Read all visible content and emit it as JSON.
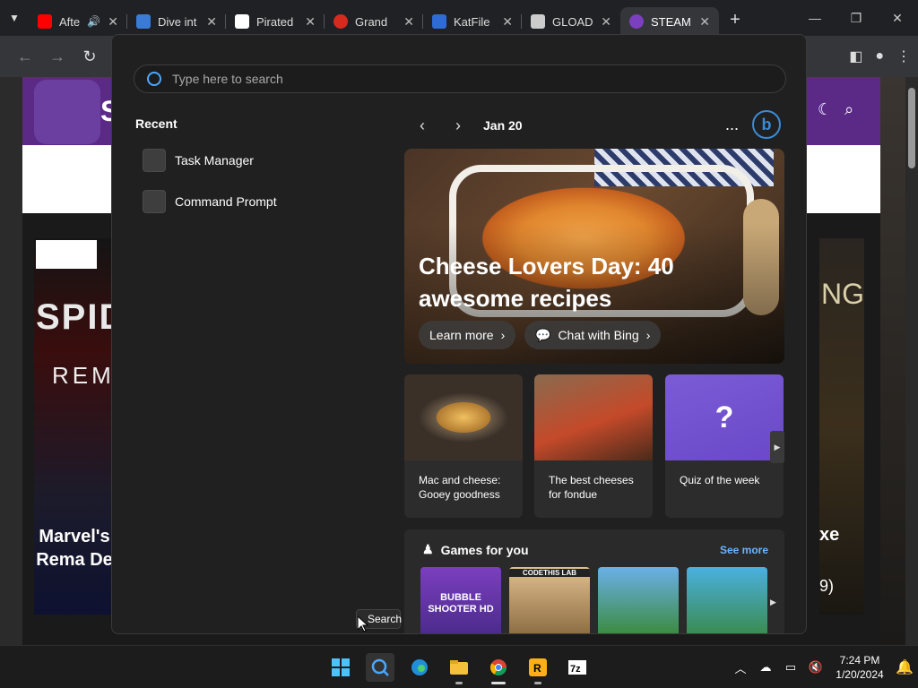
{
  "browser": {
    "tabs": [
      {
        "title": "Afte",
        "icon": "youtube-icon",
        "color": "#ff0000"
      },
      {
        "title": "Dive int",
        "icon": "dive-icon",
        "color": "#3a7bd5"
      },
      {
        "title": "Pirated",
        "icon": "piratedgames-icon",
        "color": "#ffffff"
      },
      {
        "title": "Grand",
        "icon": "mario-icon",
        "color": "#d52b1e"
      },
      {
        "title": "KatFile",
        "icon": "katfile-icon",
        "color": "#2f6bd6"
      },
      {
        "title": "GLOAD",
        "icon": "gamepad-icon",
        "color": "#cccccc"
      },
      {
        "title": "STEAM",
        "icon": "steamrip-icon",
        "color": "#7b3fbf"
      }
    ],
    "new_tab": "+"
  },
  "page": {
    "poster_left_title_1": "SPID",
    "poster_left_title_2": "REMA",
    "poster_left_caption": "Marvel's Rema De",
    "poster_right_title": "NG",
    "poster_right_caption": "xe",
    "poster_right_sub": "9)"
  },
  "search": {
    "placeholder": "Type here to search",
    "recent_heading": "Recent",
    "recent_items": [
      {
        "label": "Task Manager"
      },
      {
        "label": "Command Prompt"
      }
    ],
    "date": "Jan 20",
    "more": "...",
    "hero": {
      "title": "Cheese Lovers Day: 40 awesome recipes",
      "learn_more": "Learn more",
      "chat": "Chat with Bing"
    },
    "cards": [
      {
        "caption": "Mac and cheese: Gooey goodness"
      },
      {
        "caption": "The best cheeses for fondue"
      },
      {
        "caption": "Quiz of the week"
      }
    ],
    "games": {
      "heading": "Games for you",
      "see_more": "See more",
      "items": [
        {
          "title": "BUBBLE SHOOTER HD"
        },
        {
          "title": "CODETHIS LAB"
        },
        {
          "title": ""
        },
        {
          "title": ""
        }
      ]
    },
    "tooltip": "Search"
  },
  "taskbar": {
    "apps": [
      "windows-start",
      "search",
      "edge",
      "file-explorer",
      "chrome",
      "rockstar",
      "7zip"
    ],
    "time": "7:24 PM",
    "date": "1/20/2024"
  },
  "colors": {
    "accent": "#3a8bd6",
    "link": "#6cb4ff",
    "site_purple": "#5b2a86"
  }
}
